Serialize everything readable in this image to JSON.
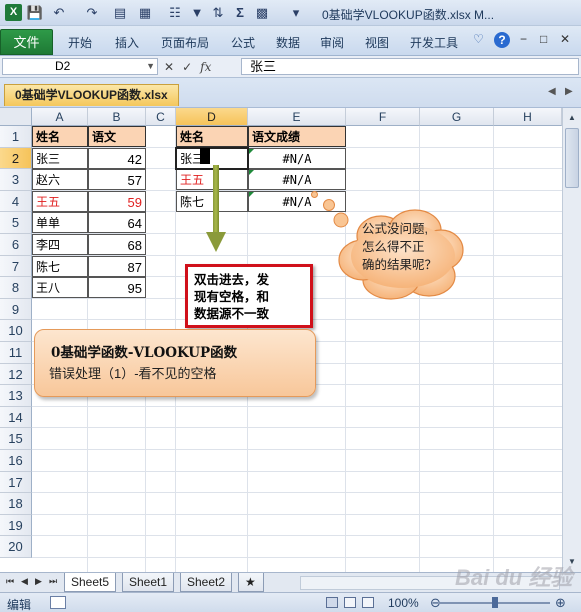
{
  "titlebar": {
    "title": "0基础学VLOOKUP函数.xlsx M..."
  },
  "ribbon": {
    "file_tab": "文件",
    "tabs": [
      "开始",
      "插入",
      "页面布局",
      "公式",
      "数据",
      "审阅",
      "视图",
      "开发工具"
    ]
  },
  "formula_bar": {
    "name_box": "D2",
    "fx_label": "fx",
    "value": "张三"
  },
  "workbook_tab": "0基础学VLOOKUP函数.xlsx",
  "columns": [
    "A",
    "B",
    "C",
    "D",
    "E",
    "F",
    "G",
    "H"
  ],
  "rows": [
    "1",
    "2",
    "3",
    "4",
    "5",
    "6",
    "7",
    "8",
    "9",
    "10",
    "11",
    "12",
    "13",
    "14",
    "15",
    "16",
    "17",
    "18",
    "19",
    "20"
  ],
  "table_left": {
    "headers": [
      "姓名",
      "语文"
    ],
    "rows": [
      {
        "name": "张三",
        "score": "42",
        "red": false
      },
      {
        "name": "赵六",
        "score": "57",
        "red": false
      },
      {
        "name": "王五",
        "score": "59",
        "red": true
      },
      {
        "name": "单单",
        "score": "64",
        "red": false
      },
      {
        "name": "李四",
        "score": "68",
        "red": false
      },
      {
        "name": "陈七",
        "score": "87",
        "red": false
      },
      {
        "name": "王八",
        "score": "95",
        "red": false
      }
    ]
  },
  "table_right": {
    "headers": [
      "姓名",
      "语文成绩"
    ],
    "rows": [
      {
        "name": "张三",
        "result": "#N/A",
        "red": false
      },
      {
        "name": "王五",
        "result": "#N/A",
        "red": true
      },
      {
        "name": "陈七",
        "result": "#N/A",
        "red": false
      }
    ]
  },
  "callouts": {
    "redbox": [
      "双击进去，发",
      "现有空格，和",
      "数据源不一致"
    ],
    "cloud": [
      "公式没问题,",
      "怎么得不正",
      "确的结果呢？"
    ],
    "orange_title": "0基础学函数-VLOOKUP函数",
    "orange_sub": "错误处理（1）-看不见的空格"
  },
  "sheet_tabs": [
    "Sheet5",
    "Sheet1",
    "Sheet2"
  ],
  "status": {
    "mode": "编辑",
    "zoom": "100%"
  },
  "watermark": "Bai du 经验",
  "colors": {
    "file_tab": "#1e7a35",
    "header_fill": "#fbd4b4",
    "red_text": "#e02020",
    "redbox_border": "#d0101a",
    "cloud_fill": "#f8c79a"
  }
}
